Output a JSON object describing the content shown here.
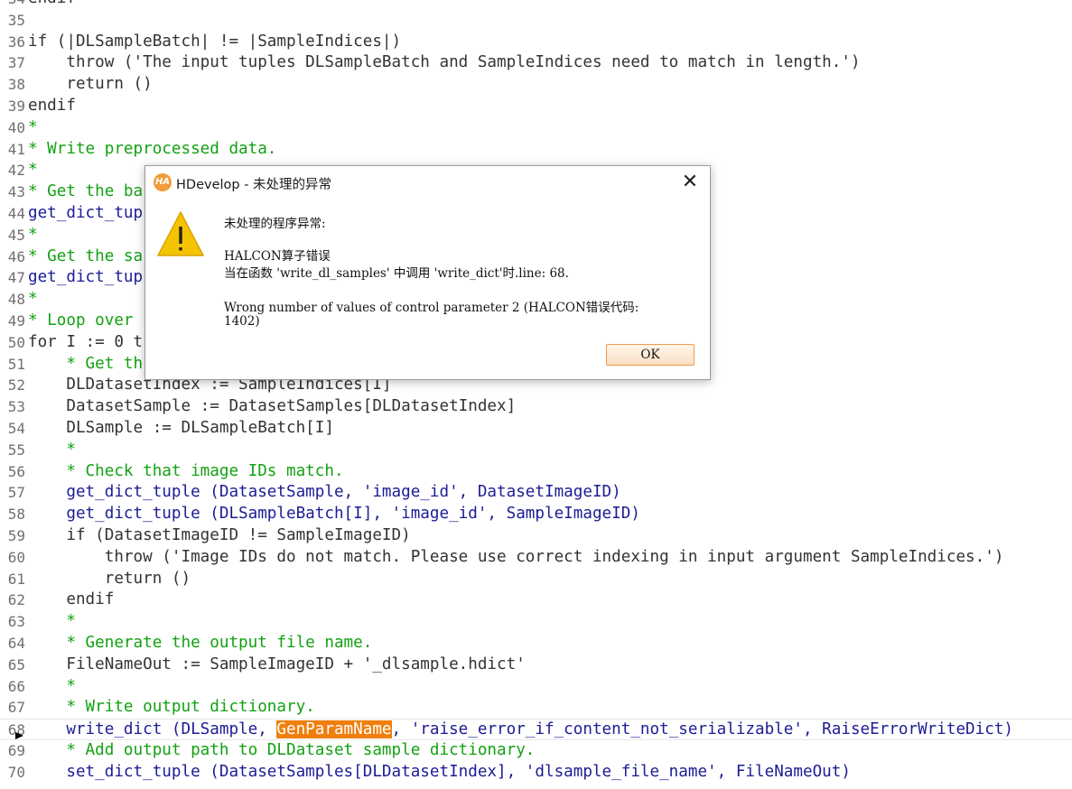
{
  "editor": {
    "lines": [
      {
        "n": "34",
        "text": "endif",
        "kind": "ctrl"
      },
      {
        "n": "35",
        "text": "",
        "kind": "plain"
      },
      {
        "n": "36",
        "text": "if (|DLSampleBatch| != |SampleIndices|)",
        "kind": "ctrl"
      },
      {
        "n": "37",
        "text": "    throw ('The input tuples DLSampleBatch and SampleIndices need to match in length.')",
        "kind": "ctrl"
      },
      {
        "n": "38",
        "text": "    return ()",
        "kind": "ctrl"
      },
      {
        "n": "39",
        "text": "endif",
        "kind": "ctrl"
      },
      {
        "n": "40",
        "text": "*",
        "kind": "comment"
      },
      {
        "n": "41",
        "text": "* Write preprocessed data.",
        "kind": "comment"
      },
      {
        "n": "42",
        "text": "*",
        "kind": "comment"
      },
      {
        "n": "43",
        "text": "* Get the ba",
        "kind": "comment"
      },
      {
        "n": "44",
        "text": "get_dict_tup",
        "kind": "op"
      },
      {
        "n": "45",
        "text": "*",
        "kind": "comment"
      },
      {
        "n": "46",
        "text": "* Get the sa",
        "kind": "comment"
      },
      {
        "n": "47",
        "text": "get_dict_tup",
        "kind": "op"
      },
      {
        "n": "48",
        "text": "*",
        "kind": "comment"
      },
      {
        "n": "49",
        "text": "* Loop over",
        "kind": "comment"
      },
      {
        "n": "50",
        "text": "for I := 0 t",
        "kind": "ctrl"
      },
      {
        "n": "51",
        "text": "    * Get th",
        "kind": "comment"
      },
      {
        "n": "52",
        "text": "    DLDatasetIndex := SampleIndices[I]",
        "kind": "plain"
      },
      {
        "n": "53",
        "text": "    DatasetSample := DatasetSamples[DLDatasetIndex]",
        "kind": "plain"
      },
      {
        "n": "54",
        "text": "    DLSample := DLSampleBatch[I]",
        "kind": "plain"
      },
      {
        "n": "55",
        "text": "    *",
        "kind": "comment"
      },
      {
        "n": "56",
        "text": "    * Check that image IDs match.",
        "kind": "comment"
      },
      {
        "n": "57",
        "text": "    get_dict_tuple (DatasetSample, 'image_id', DatasetImageID)",
        "kind": "op"
      },
      {
        "n": "58",
        "text": "    get_dict_tuple (DLSampleBatch[I], 'image_id', SampleImageID)",
        "kind": "op"
      },
      {
        "n": "59",
        "text": "    if (DatasetImageID != SampleImageID)",
        "kind": "ctrl"
      },
      {
        "n": "60",
        "text": "        throw ('Image IDs do not match. Please use correct indexing in input argument SampleIndices.')",
        "kind": "ctrl"
      },
      {
        "n": "61",
        "text": "        return ()",
        "kind": "ctrl"
      },
      {
        "n": "62",
        "text": "    endif",
        "kind": "ctrl"
      },
      {
        "n": "63",
        "text": "    *",
        "kind": "comment"
      },
      {
        "n": "64",
        "text": "    * Generate the output file name.",
        "kind": "comment"
      },
      {
        "n": "65",
        "text": "    FileNameOut := SampleImageID + '_dlsample.hdict'",
        "kind": "plain"
      },
      {
        "n": "66",
        "text": "    *",
        "kind": "comment"
      },
      {
        "n": "67",
        "text": "    * Write output dictionary.",
        "kind": "comment"
      },
      {
        "n": "68",
        "text_before": "    write_dict (DLSample, ",
        "highlight": "GenParamName",
        "text_after": ", 'raise_error_if_content_not_serializable', RaiseErrorWriteDict)",
        "kind": "op",
        "current": true
      },
      {
        "n": "69",
        "text": "    * Add output path to DLDataset sample dictionary.",
        "kind": "comment"
      },
      {
        "n": "70",
        "text": "    set_dict_tuple (DatasetSamples[DLDatasetIndex], 'dlsample_file_name', FileNameOut)",
        "kind": "op"
      }
    ]
  },
  "dialog": {
    "app_icon_text": "HA",
    "title": "HDevelop - 未处理的异常",
    "header": "未处理的程序异常:",
    "error_title": "HALCON算子错误",
    "location": "当在函数 'write_dl_samples' 中调用 'write_dict'时.line: 68.",
    "detail_line1": "Wrong number of values of control parameter 2 (HALCON错误代码:",
    "detail_line2": "1402)",
    "ok_label": "OK",
    "close_glyph": "✕",
    "icon": "warning-icon",
    "colors": {
      "accent": "#f29b3a",
      "warning": "#f5c400",
      "button_border": "#f09a4c"
    }
  }
}
